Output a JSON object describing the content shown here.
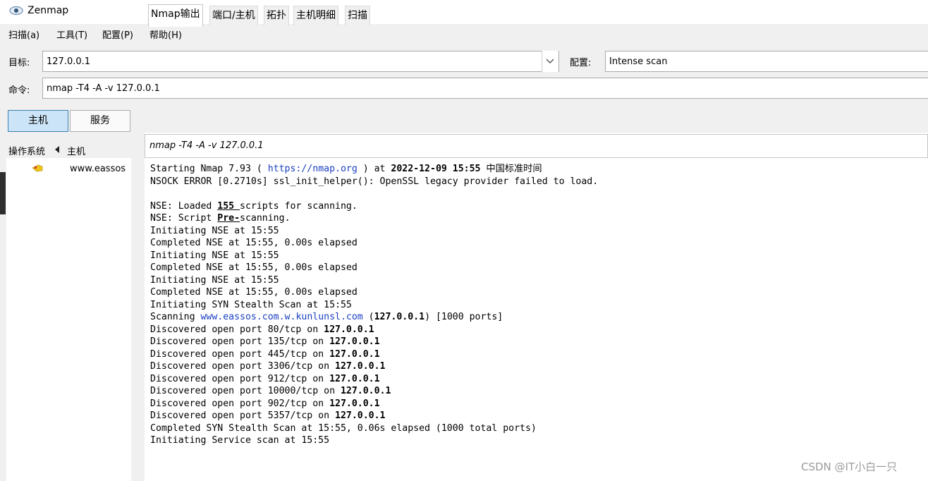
{
  "window": {
    "title": "Zenmap"
  },
  "menu": {
    "items": [
      "扫描(a)",
      "工具(T)",
      "配置(P)",
      "帮助(H)"
    ]
  },
  "target": {
    "label": "目标:",
    "value": "127.0.0.1"
  },
  "profile": {
    "label": "配置:",
    "value": "Intense scan"
  },
  "command": {
    "label": "命令:",
    "value": "nmap -T4 -A -v 127.0.0.1"
  },
  "left_pane": {
    "hosts_button": "主机",
    "services_button": "服务",
    "col_os": "操作系统",
    "col_host": "主机",
    "hosts": [
      {
        "name": "www.eassos"
      }
    ]
  },
  "tabs": [
    "Nmap输出",
    "端口/主机",
    "拓扑",
    "主机明细",
    "扫描"
  ],
  "active_tab": 0,
  "output": {
    "command_display": "nmap -T4 -A -v 127.0.0.1",
    "lines": {
      "l1_a": "Starting Nmap 7.93 ( ",
      "l1_url": "https://nmap.org",
      "l1_b": " ) at ",
      "l1_date": "2022-12-09 15:55",
      "l1_c": " 中国标准时间",
      "l2": "NSOCK ERROR [0.2710s] ssl_init_helper(): OpenSSL legacy provider failed to load.",
      "l4_a": "NSE: Loaded ",
      "l4_num": "155 ",
      "l4_b": "scripts for scanning.",
      "l5_a": "NSE: Script ",
      "l5_pre": "Pre-",
      "l5_b": "scanning.",
      "l6": "Initiating NSE at 15:55",
      "l7": "Completed NSE at 15:55, 0.00s elapsed",
      "l8": "Initiating NSE at 15:55",
      "l9": "Completed NSE at 15:55, 0.00s elapsed",
      "l10": "Initiating NSE at 15:55",
      "l11": "Completed NSE at 15:55, 0.00s elapsed",
      "l12": "Initiating SYN Stealth Scan at 15:55",
      "l13_a": "Scanning ",
      "l13_host": "www.eassos.com.w.kunlunsl.com",
      "l13_b": " (",
      "l13_ip": "127.0.0.1",
      "l13_c": ") [1000 ports]",
      "ip": "127.0.0.1",
      "d1": "Discovered open port 80/tcp on ",
      "d2": "Discovered open port 135/tcp on ",
      "d3": "Discovered open port 445/tcp on ",
      "d4": "Discovered open port 3306/tcp on ",
      "d5": "Discovered open port 912/tcp on ",
      "d6": "Discovered open port 10000/tcp on ",
      "d7": "Discovered open port 902/tcp on ",
      "d8": "Discovered open port 5357/tcp on ",
      "l22": "Completed SYN Stealth Scan at 15:55, 0.06s elapsed (1000 total ports)",
      "l23": "Initiating Service scan at 15:55"
    }
  },
  "watermark": "CSDN @IT小白一只",
  "colors": {
    "link": "#1a40c0",
    "active_button": "#cce4f7"
  }
}
